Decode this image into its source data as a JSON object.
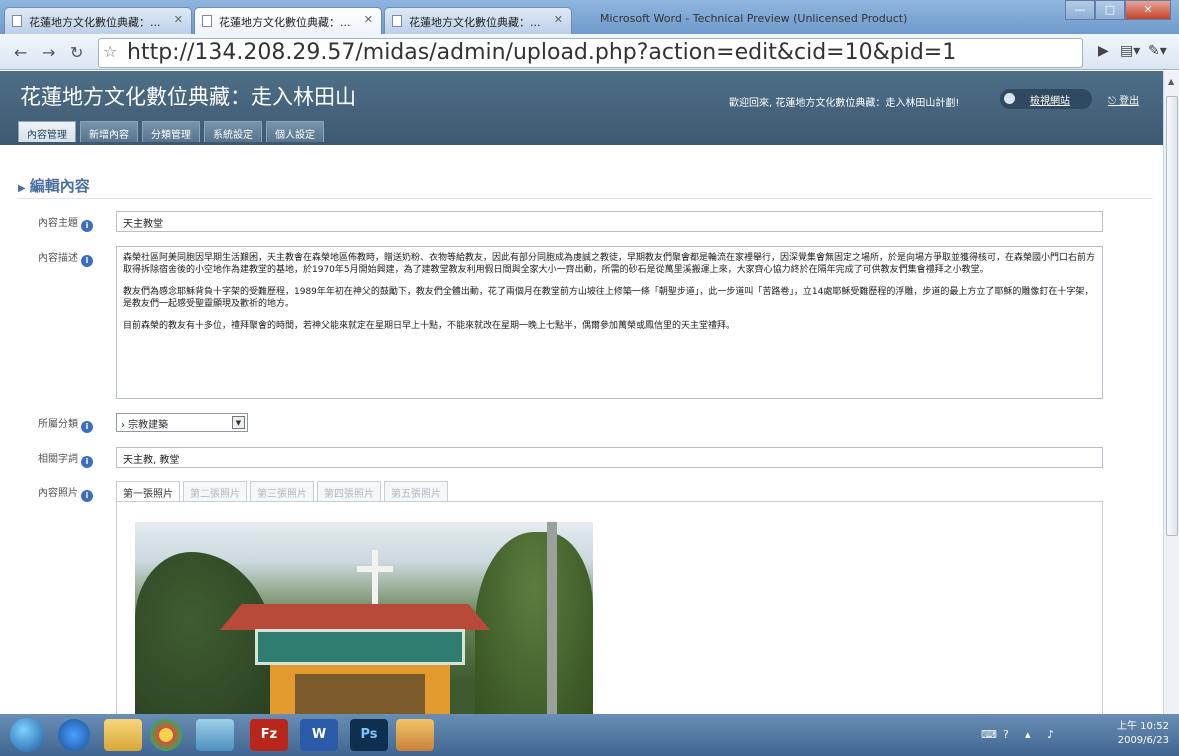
{
  "browser": {
    "tabs": [
      {
        "label": "花蓮地方文化數位典藏：..."
      },
      {
        "label": "花蓮地方文化數位典藏：..."
      },
      {
        "label": "花蓮地方文化數位典藏：..."
      }
    ],
    "extension_tab": "Microsoft Word - Technical Preview (Unlicensed Product)",
    "url": "http://134.208.29.57/midas/admin/upload.php?action=edit&cid=10&pid=1",
    "window_controls": {
      "minimize": "—",
      "maximize": "□",
      "close": "✕"
    }
  },
  "admin": {
    "site_title": "花蓮地方文化數位典藏：走入林田山",
    "welcome": "歡迎回來, 花蓮地方文化數位典藏：走入林田山計劃!",
    "site_link": "檢視網站",
    "logout": "登出",
    "menu": [
      {
        "label": "內容管理"
      },
      {
        "label": "新增內容"
      },
      {
        "label": "分類管理"
      },
      {
        "label": "系統設定"
      },
      {
        "label": "個人設定"
      }
    ]
  },
  "form": {
    "section_title": "編輯內容",
    "subject": {
      "label": "內容主題",
      "value": "天主教堂"
    },
    "description": {
      "label": "內容描述",
      "paragraphs": [
        "森榮社區阿美同胞因早期生活艱困，天主教會在森榮地區佈教時，贈送奶粉、衣物等給教友，因此有部分同胞成為虔誠之教徒，早期教友們聚會都是輪流在家裡舉行，因深覺集會無固定之場所，於是向場方爭取並獲得核可，在森榮國小門口右前方取得拆除宿舍後的小空地作為建教堂的基地，於1970年5月開始興建，為了建教堂教友利用假日間與全家大小一齊出動，所需的砂石是從萬里溪搬運上來，大家齊心協力終於在隔年完成了可供教友們集會禮拜之小教堂。",
        "教友們為感念耶穌背負十字架的受難歷程，1989年年初在神父的鼓勵下，教友們全體出動，花了兩個月在教堂前方山坡往上修築一條「朝聖步道」，此一步道叫「苦路卷」，立14處耶穌受難歷程的浮雕，步道的最上方立了耶穌的雕像釘在十字架，是教友們一起感受聖靈顯現及歡祈的地方。",
        "目前森榮的教友有十多位，禮拜聚會的時間，若神父能來就定在星期日早上十點，不能來就改在星期一晚上七點半，偶爾參加萬榮或鳳信里的天主堂禮拜。"
      ]
    },
    "category": {
      "label": "所屬分類",
      "value": "› 宗教建築"
    },
    "keywords": {
      "label": "相關字詞",
      "value": "天主教, 教堂"
    },
    "photos": {
      "label": "內容照片",
      "tabs": [
        {
          "label": "第一張照片"
        },
        {
          "label": "第二張照片"
        },
        {
          "label": "第三張照片"
        },
        {
          "label": "第四張照片"
        },
        {
          "label": "第五張照片"
        }
      ]
    }
  },
  "taskbar": {
    "apps": [
      "Ps",
      "Fz",
      "W"
    ],
    "time": "上午 10:52",
    "date": "2009/6/23"
  }
}
